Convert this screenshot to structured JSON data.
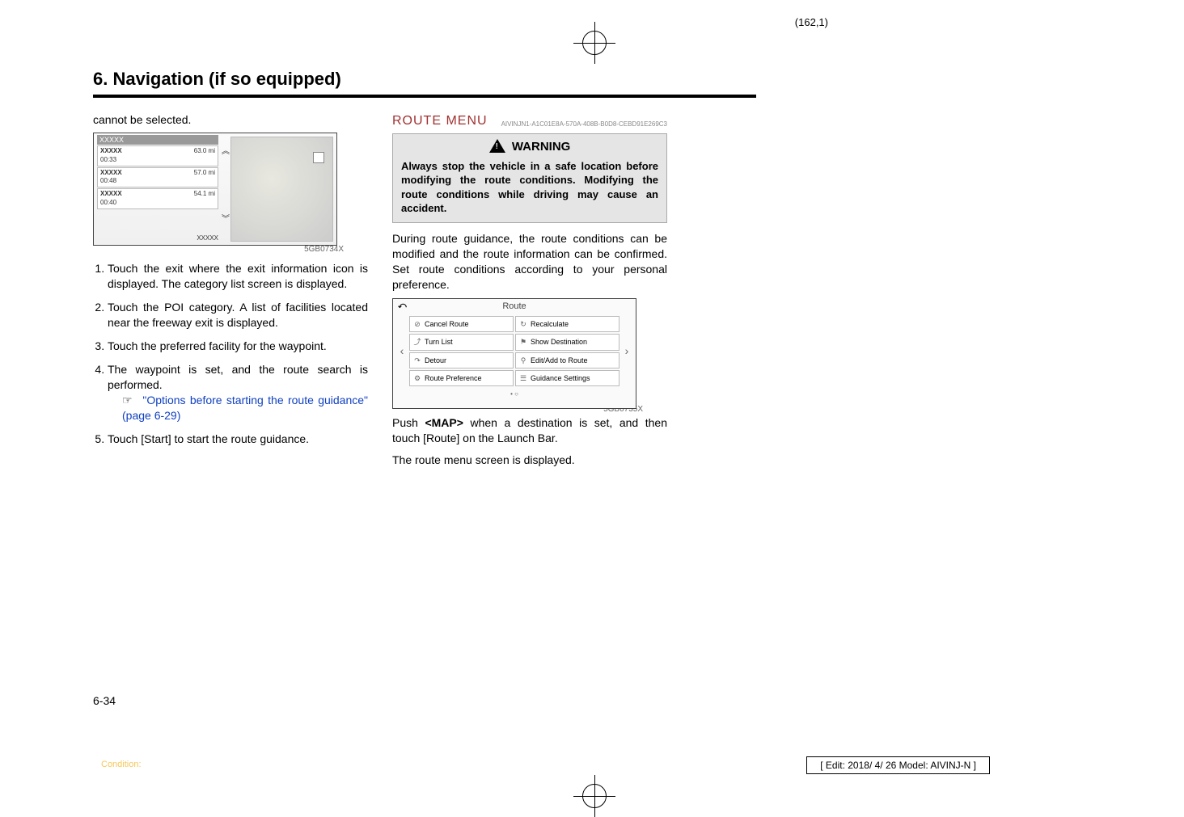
{
  "page_indicator": "(162,1)",
  "chapter": "6. Navigation (if so equipped)",
  "left_col": {
    "continued": "cannot be selected.",
    "freeway": {
      "header": "XXXXX",
      "rows": [
        {
          "name": "XXXXX",
          "sub": "00:33",
          "dist": "63.0 mi"
        },
        {
          "name": "XXXXX",
          "sub": "00:48",
          "dist": "57.0 mi"
        },
        {
          "name": "XXXXX",
          "sub": "00:40",
          "dist": "54.1 mi"
        }
      ],
      "bottom_left": "",
      "bottom_right": "XXXXX"
    },
    "img_ref1": "5GB0734X",
    "steps": [
      "Touch the exit where the exit information icon is displayed. The category list screen is displayed.",
      "Touch the POI category. A list of facilities located near the freeway exit is displayed.",
      "Touch the preferred facility for the waypoint.",
      "The waypoint is set, and the route search is performed.",
      "Touch [Start] to start the route guidance."
    ],
    "ref_text": "\"Options before starting the route guidance\" (page 6-29)"
  },
  "right_col": {
    "section": "ROUTE MENU",
    "guid": "AIVINJN1-A1C01E8A-570A-408B-B0D8-CEBD91E269C3",
    "warning_label": "WARNING",
    "warning_text": "Always stop the vehicle in a safe location before modifying the route conditions. Modifying the route conditions while driving may cause an accident.",
    "para1": "During route guidance, the route conditions can be modified and the route information can be confirmed. Set route conditions according to your personal preference.",
    "route_shot": {
      "title": "Route",
      "buttons": [
        {
          "icon": "⊘",
          "label": "Cancel Route"
        },
        {
          "icon": "↻",
          "label": "Recalculate"
        },
        {
          "icon": "⤴",
          "label": "Turn List"
        },
        {
          "icon": "⚑",
          "label": "Show Destination"
        },
        {
          "icon": "↷",
          "label": "Detour"
        },
        {
          "icon": "⚲",
          "label": "Edit/Add to Route"
        },
        {
          "icon": "⚙",
          "label": "Route Preference"
        },
        {
          "icon": "☰",
          "label": "Guidance Settings"
        }
      ]
    },
    "img_ref2": "5GB0735X",
    "para2": "Push <MAP> when a destination is set, and then touch [Route] on the Launch Bar.",
    "para3": "The route menu screen is displayed."
  },
  "page_num": "6-34",
  "condition_label": "Condition:",
  "edit_box": "[ Edit: 2018/ 4/ 26   Model:  AIVINJ-N ]"
}
